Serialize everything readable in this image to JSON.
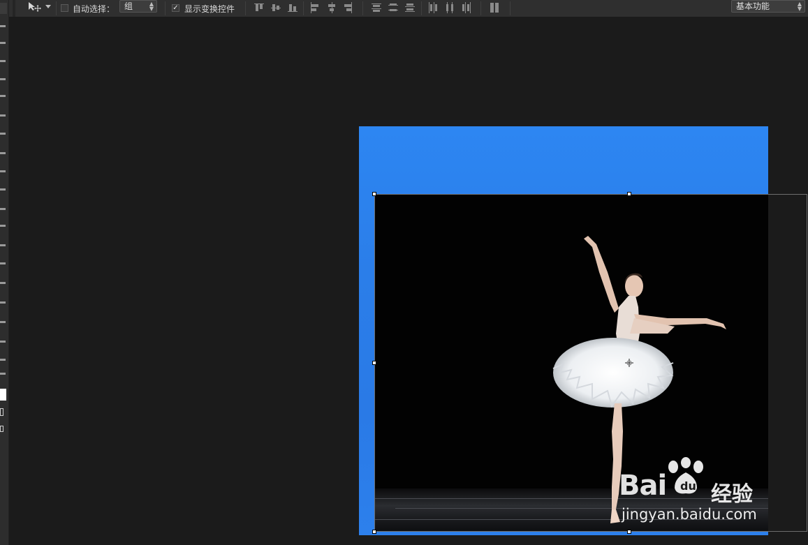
{
  "options_bar": {
    "auto_select_label": "自动选择：",
    "auto_select_checked": false,
    "auto_select_target": "组",
    "show_transform_label": "显示变换控件",
    "show_transform_checked": true,
    "workspace": "基本功能"
  },
  "icons": {
    "move_tool": "move-tool-icon",
    "tool_preset_arrow": "chevron-down-icon",
    "align": [
      "align-top-edges-icon",
      "align-vertical-centers-icon",
      "align-bottom-edges-icon",
      "align-left-edges-icon",
      "align-horizontal-centers-icon",
      "align-right-edges-icon"
    ],
    "distribute": [
      "distribute-top-edges-icon",
      "distribute-vertical-centers-icon",
      "distribute-bottom-edges-icon",
      "distribute-left-edges-icon",
      "distribute-horizontal-centers-icon",
      "distribute-right-edges-icon"
    ],
    "auto_align": "auto-align-layers-icon",
    "reference_point": "crosshair-icon"
  },
  "colors": {
    "canvas_bg": "#1b1b1b",
    "options_bar": "#2f2f2f",
    "document_blue": "#2b7ee9",
    "photo_bg": "#020202",
    "foreground_swatch": "#ffffff"
  },
  "watermark": {
    "brand_text": "Bai",
    "brand_suffix": "经验",
    "site": "jingyan.baidu.com"
  }
}
